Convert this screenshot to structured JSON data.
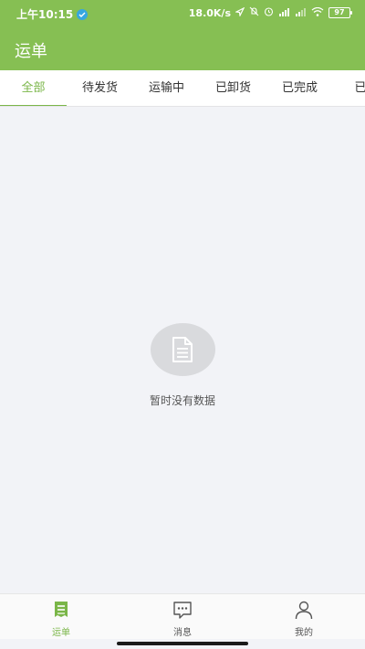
{
  "status_bar": {
    "time": "上午10:15",
    "speed": "18.0K/s",
    "battery": "97"
  },
  "header": {
    "title": "运单"
  },
  "tabs": [
    {
      "label": "全部",
      "active": true
    },
    {
      "label": "待发货",
      "active": false
    },
    {
      "label": "运输中",
      "active": false
    },
    {
      "label": "已卸货",
      "active": false
    },
    {
      "label": "已完成",
      "active": false
    },
    {
      "label": "已取",
      "active": false
    }
  ],
  "empty_state": {
    "icon": "document-icon",
    "message": "暂时没有数据"
  },
  "bottom_nav": [
    {
      "label": "运单",
      "icon": "waybill-icon",
      "active": true
    },
    {
      "label": "消息",
      "icon": "message-icon",
      "active": false
    },
    {
      "label": "我的",
      "icon": "user-icon",
      "active": false
    }
  ],
  "colors": {
    "brand": "#86bf53",
    "accent": "#7ab648",
    "background": "#f2f3f7"
  }
}
